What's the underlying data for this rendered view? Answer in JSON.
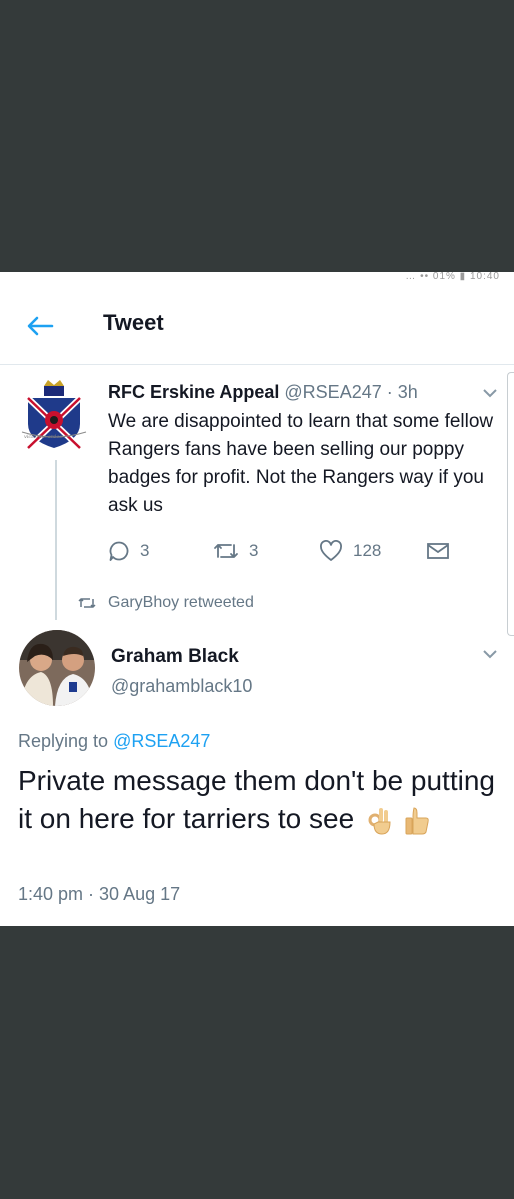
{
  "status_bar": {
    "text": "… •• 01% ▮ 10:40"
  },
  "header": {
    "title": "Tweet"
  },
  "quoted_tweet": {
    "name": "RFC Erskine Appeal",
    "handle": "@RSEA247",
    "time": "· 3h",
    "text": "We are disappointed to learn that some fellow Rangers fans have been selling our poppy badges for profit. Not the Rangers way if you ask us",
    "avatar_icon": "erskine-crest-icon",
    "reply_count": "3",
    "retweet_count": "3",
    "like_count": "128"
  },
  "retweet_notice": {
    "text": "GaryBhoy retweeted"
  },
  "reply_tweet": {
    "name": "Graham Black",
    "handle": "@grahamblack10",
    "replying_prefix": "Replying to",
    "replying_handle": "@RSEA247",
    "text": "Private message them don't be putting it on here for tarriers to see",
    "emojis": [
      "ok-hand-icon",
      "thumbs-up-icon"
    ],
    "timestamp": "1:40 pm · 30 Aug 17"
  },
  "colors": {
    "accent": "#1da1f2",
    "text": "#141823",
    "secondary": "#657786",
    "frame": "#343a3a"
  }
}
